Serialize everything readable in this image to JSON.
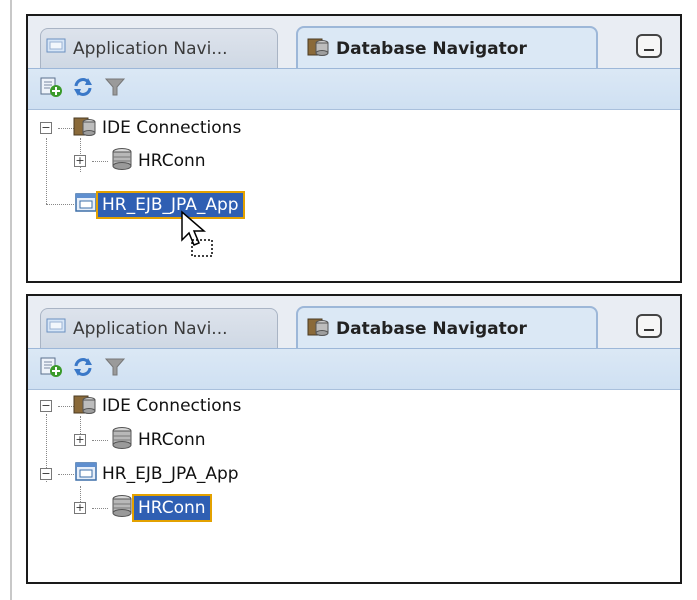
{
  "panels": [
    {
      "tabs": {
        "application_navigator": "Application Navi...",
        "database_navigator": "Database Navigator"
      },
      "tree": {
        "ide_connections": "IDE Connections",
        "hrconn": "HRConn",
        "app": "HR_EJB_JPA_App"
      }
    },
    {
      "tabs": {
        "application_navigator": "Application Navi...",
        "database_navigator": "Database Navigator"
      },
      "tree": {
        "ide_connections": "IDE Connections",
        "hrconn": "HRConn",
        "app": "HR_EJB_JPA_App",
        "app_hrconn": "HRConn"
      }
    }
  ],
  "icons": {
    "tab_application": "application-icon",
    "tab_database": "database-navigator-icon",
    "new_connection": "new-connection-icon",
    "refresh": "refresh-icon",
    "filter": "filter-icon",
    "minimize": "minimize-icon",
    "connections_folder": "connections-folder-icon",
    "database": "database-icon",
    "application": "application-icon",
    "cursor": "drag-cursor-icon"
  },
  "colors": {
    "selection_bg": "#2f5fb3",
    "selection_border": "#e3a100",
    "toolbar_bg": "#dbe8f5"
  }
}
